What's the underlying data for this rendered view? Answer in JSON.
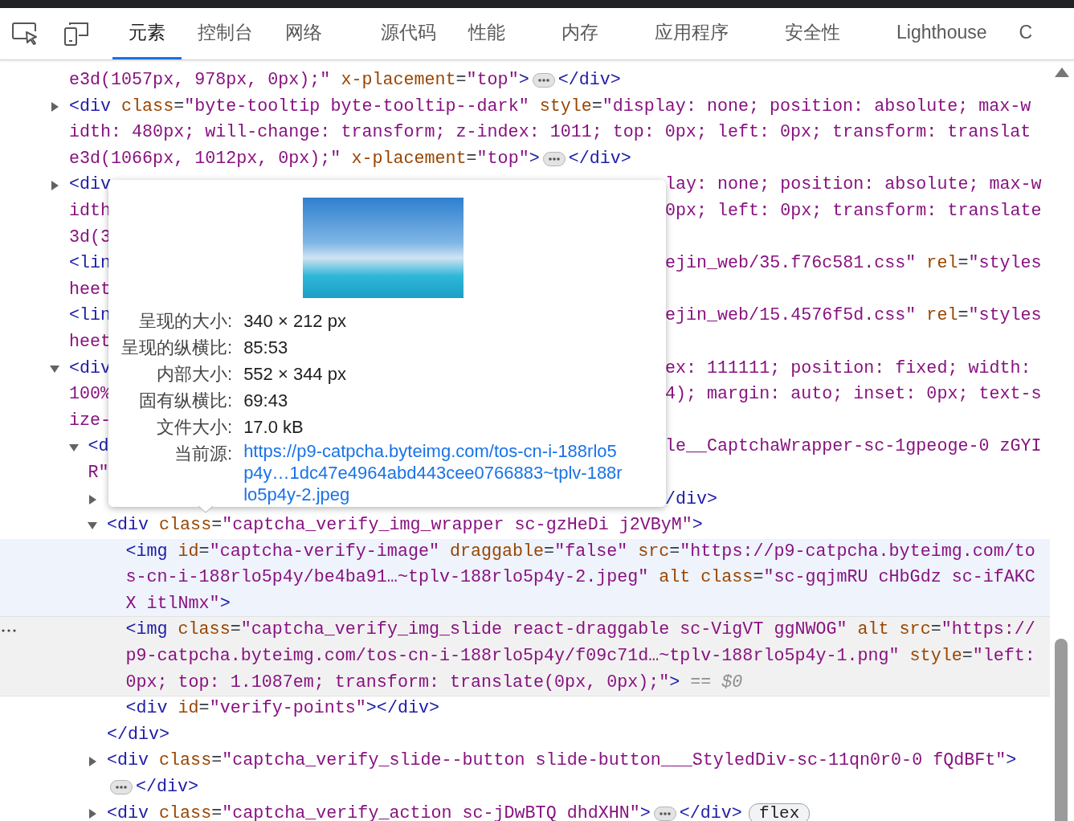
{
  "tabs": [
    {
      "label": "元素",
      "selected": true
    },
    {
      "label": "控制台",
      "selected": false
    },
    {
      "label": "网络",
      "selected": false
    },
    {
      "label": "源代码",
      "selected": false
    },
    {
      "label": "性能",
      "selected": false
    },
    {
      "label": "内存",
      "selected": false
    },
    {
      "label": "应用程序",
      "selected": false
    },
    {
      "label": "安全性",
      "selected": false
    },
    {
      "label": "Lighthouse",
      "selected": false
    },
    {
      "label": "C",
      "selected": false
    }
  ],
  "nodes": [
    {
      "hovered": false,
      "selected": false,
      "lines": [
        [
          {
            "kind": "code",
            "tokens": [
              {
                "kind": "val",
                "text": "e3d(1057px, 978px, 0px);\""
              },
              {
                "kind": "attr",
                "text": " x-placement"
              },
              {
                "kind": "txt",
                "text": "="
              },
              {
                "kind": "val",
                "text": "\"top\""
              },
              {
                "kind": "tag",
                "text": ">"
              }
            ]
          },
          {
            "kind": "ellipsis"
          },
          {
            "kind": "code",
            "tokens": [
              {
                "kind": "tag",
                "text": "</div>"
              }
            ]
          }
        ]
      ]
    },
    {
      "expanded": false,
      "hovered": false,
      "selected": false,
      "lines": [
        [
          {
            "kind": "code",
            "tokens": [
              {
                "kind": "tag",
                "text": "<div"
              },
              {
                "kind": "attr",
                "text": " class"
              },
              {
                "kind": "txt",
                "text": "="
              },
              {
                "kind": "val",
                "text": "\"byte-tooltip byte-tooltip--dark\""
              },
              {
                "kind": "attr",
                "text": " style"
              },
              {
                "kind": "txt",
                "text": "="
              },
              {
                "kind": "val",
                "text": "\"display: none; position: absolute; max-w"
              }
            ]
          }
        ],
        [
          {
            "kind": "code",
            "tokens": [
              {
                "kind": "val",
                "text": "idth: 480px; will-change: transform; z-index: 1011; top: 0px; left: 0px; transform: translat"
              }
            ]
          }
        ],
        [
          {
            "kind": "code",
            "tokens": [
              {
                "kind": "val",
                "text": "e3d(1066px, 1012px, 0px);\""
              },
              {
                "kind": "attr",
                "text": " x-placement"
              },
              {
                "kind": "txt",
                "text": "="
              },
              {
                "kind": "val",
                "text": "\"top\""
              },
              {
                "kind": "tag",
                "text": ">"
              }
            ]
          },
          {
            "kind": "ellipsis"
          },
          {
            "kind": "code",
            "tokens": [
              {
                "kind": "tag",
                "text": "</div>"
              }
            ]
          }
        ]
      ]
    },
    {
      "expanded": false,
      "hovered": false,
      "selected": false,
      "lines": [
        [
          {
            "kind": "code",
            "tokens": [
              {
                "kind": "tag",
                "text": "<div"
              }
            ]
          },
          {
            "kind": "gap"
          },
          {
            "kind": "code",
            "tokens": [
              {
                "kind": "val",
                "text": "lay: none; position: absolute; max-w"
              }
            ]
          }
        ],
        [
          {
            "kind": "code",
            "tokens": [
              {
                "kind": "val",
                "text": "idth"
              }
            ]
          },
          {
            "kind": "gap"
          },
          {
            "kind": "code",
            "tokens": [
              {
                "kind": "val",
                "text": "0px; left: 0px; transform: translate"
              }
            ]
          }
        ],
        [
          {
            "kind": "code",
            "tokens": [
              {
                "kind": "val",
                "text": "3d(3"
              }
            ]
          }
        ]
      ]
    },
    {
      "hovered": false,
      "selected": false,
      "lines": [
        [
          {
            "kind": "code",
            "tokens": [
              {
                "kind": "tag",
                "text": "<lin"
              }
            ]
          },
          {
            "kind": "gap"
          },
          {
            "kind": "code",
            "tokens": [
              {
                "kind": "val",
                "text": "ejin_web/35.f76c581.css\""
              },
              {
                "kind": "attr",
                "text": " rel"
              },
              {
                "kind": "txt",
                "text": "="
              },
              {
                "kind": "val",
                "text": "\"styles"
              }
            ]
          }
        ],
        [
          {
            "kind": "code",
            "tokens": [
              {
                "kind": "val",
                "text": "heet"
              }
            ]
          }
        ]
      ]
    },
    {
      "hovered": false,
      "selected": false,
      "lines": [
        [
          {
            "kind": "code",
            "tokens": [
              {
                "kind": "tag",
                "text": "<lin"
              }
            ]
          },
          {
            "kind": "gap"
          },
          {
            "kind": "code",
            "tokens": [
              {
                "kind": "val",
                "text": "ejin_web/15.4576f5d.css\""
              },
              {
                "kind": "attr",
                "text": " rel"
              },
              {
                "kind": "txt",
                "text": "="
              },
              {
                "kind": "val",
                "text": "\"styles"
              }
            ]
          }
        ],
        [
          {
            "kind": "code",
            "tokens": [
              {
                "kind": "val",
                "text": "heet"
              }
            ]
          }
        ]
      ]
    },
    {
      "expanded": true,
      "hovered": false,
      "selected": false,
      "lines": [
        [
          {
            "kind": "code",
            "tokens": [
              {
                "kind": "tag",
                "text": "<div"
              }
            ]
          },
          {
            "kind": "gap"
          },
          {
            "kind": "code",
            "tokens": [
              {
                "kind": "val",
                "text": "ex: 111111; position: fixed; width:"
              }
            ]
          }
        ],
        [
          {
            "kind": "code",
            "tokens": [
              {
                "kind": "val",
                "text": "100%"
              }
            ]
          },
          {
            "kind": "gap"
          },
          {
            "kind": "code",
            "tokens": [
              {
                "kind": "val",
                "text": "4); margin: auto; inset: 0px; text-s"
              }
            ]
          }
        ],
        [
          {
            "kind": "code",
            "tokens": [
              {
                "kind": "val",
                "text": "ize-"
              }
            ]
          }
        ]
      ],
      "children": [
        {
          "expanded": true,
          "hovered": false,
          "selected": false,
          "lines": [
            [
              {
                "kind": "code",
                "tokens": [
                  {
                    "kind": "tag",
                    "text": "<d"
                  }
                ]
              },
              {
                "kind": "gap"
              },
              {
                "kind": "code",
                "tokens": [
                  {
                    "kind": "val",
                    "text": "le__CaptchaWrapper-sc-1gpeoge-0 zGYI"
                  }
                ]
              }
            ],
            [
              {
                "kind": "code",
                "tokens": [
                  {
                    "kind": "val",
                    "text": "R\""
                  }
                ]
              }
            ]
          ],
          "children": [
            {
              "expanded": false,
              "hovered": false,
              "selected": false,
              "lines": [
                [
                  {
                    "kind": "gap"
                  },
                  {
                    "kind": "code",
                    "tokens": [
                      {
                        "kind": "tag",
                        "text": "/div>"
                      }
                    ]
                  }
                ]
              ]
            },
            {
              "expanded": true,
              "hovered": false,
              "selected": false,
              "lines": [
                [
                  {
                    "kind": "code",
                    "tokens": [
                      {
                        "kind": "tag",
                        "text": "<div"
                      },
                      {
                        "kind": "attr",
                        "text": " class"
                      },
                      {
                        "kind": "txt",
                        "text": "="
                      },
                      {
                        "kind": "val",
                        "text": "\"captcha_verify_img_wrapper sc-gzHeDi j2VByM\""
                      },
                      {
                        "kind": "tag",
                        "text": ">"
                      }
                    ]
                  }
                ]
              ],
              "children": [
                {
                  "hovered": true,
                  "selected": false,
                  "lines": [
                    [
                      {
                        "kind": "code",
                        "tokens": [
                          {
                            "kind": "tag",
                            "text": "<img"
                          },
                          {
                            "kind": "attr",
                            "text": " id"
                          },
                          {
                            "kind": "txt",
                            "text": "="
                          },
                          {
                            "kind": "val",
                            "text": "\"captcha-verify-image\""
                          },
                          {
                            "kind": "attr",
                            "text": " draggable"
                          },
                          {
                            "kind": "txt",
                            "text": "="
                          },
                          {
                            "kind": "val",
                            "text": "\"false\""
                          },
                          {
                            "kind": "attr",
                            "text": " src"
                          },
                          {
                            "kind": "txt",
                            "text": "="
                          },
                          {
                            "kind": "val",
                            "text": "\"https://p9-catpcha.byteimg.com/to"
                          }
                        ]
                      }
                    ],
                    [
                      {
                        "kind": "code",
                        "tokens": [
                          {
                            "kind": "val",
                            "text": "s-cn-i-188rlo5p4y/be4ba91…~tplv-188rlo5p4y-2.jpeg\""
                          },
                          {
                            "kind": "attr",
                            "text": " alt class"
                          },
                          {
                            "kind": "txt",
                            "text": "="
                          },
                          {
                            "kind": "val",
                            "text": "\"sc-gqjmRU cHbGdz sc-ifAKC"
                          }
                        ]
                      }
                    ],
                    [
                      {
                        "kind": "code",
                        "tokens": [
                          {
                            "kind": "val",
                            "text": "X itlNmx\""
                          },
                          {
                            "kind": "tag",
                            "text": ">"
                          }
                        ]
                      }
                    ]
                  ]
                },
                {
                  "hovered": false,
                  "selected": true,
                  "lines": [
                    [
                      {
                        "kind": "code",
                        "tokens": [
                          {
                            "kind": "tag",
                            "text": "<img"
                          },
                          {
                            "kind": "attr",
                            "text": " class"
                          },
                          {
                            "kind": "txt",
                            "text": "="
                          },
                          {
                            "kind": "val",
                            "text": "\"captcha_verify_img_slide react-draggable sc-VigVT ggNWOG\""
                          },
                          {
                            "kind": "attr",
                            "text": " alt src"
                          },
                          {
                            "kind": "txt",
                            "text": "="
                          },
                          {
                            "kind": "val",
                            "text": "\"https://"
                          }
                        ]
                      }
                    ],
                    [
                      {
                        "kind": "code",
                        "tokens": [
                          {
                            "kind": "val",
                            "text": "p9-catpcha.byteimg.com/tos-cn-i-188rlo5p4y/f09c71d…~tplv-188rlo5p4y-1.png\""
                          },
                          {
                            "kind": "attr",
                            "text": " style"
                          },
                          {
                            "kind": "txt",
                            "text": "="
                          },
                          {
                            "kind": "val",
                            "text": "\"left:"
                          }
                        ]
                      }
                    ],
                    [
                      {
                        "kind": "code",
                        "tokens": [
                          {
                            "kind": "val",
                            "text": "0px; top: 1.1087em; transform: translate(0px, 0px);\""
                          },
                          {
                            "kind": "tag",
                            "text": ">"
                          },
                          {
                            "kind": "dim",
                            "text": " == $0"
                          }
                        ]
                      }
                    ]
                  ]
                },
                {
                  "hovered": false,
                  "selected": false,
                  "lines": [
                    [
                      {
                        "kind": "code",
                        "tokens": [
                          {
                            "kind": "tag",
                            "text": "<div"
                          },
                          {
                            "kind": "attr",
                            "text": " id"
                          },
                          {
                            "kind": "txt",
                            "text": "="
                          },
                          {
                            "kind": "val",
                            "text": "\"verify-points\""
                          },
                          {
                            "kind": "tag",
                            "text": "></div>"
                          }
                        ]
                      }
                    ]
                  ]
                }
              ],
              "closing": [
                {
                  "kind": "code",
                  "tokens": [
                    {
                      "kind": "tag",
                      "text": "</div>"
                    }
                  ]
                }
              ]
            },
            {
              "expanded": false,
              "hovered": false,
              "selected": false,
              "lines": [
                [
                  {
                    "kind": "code",
                    "tokens": [
                      {
                        "kind": "tag",
                        "text": "<div"
                      },
                      {
                        "kind": "attr",
                        "text": " class"
                      },
                      {
                        "kind": "txt",
                        "text": "="
                      },
                      {
                        "kind": "val",
                        "text": "\"captcha_verify_slide--button slide-button___StyledDiv-sc-11qn0r0-0 fQdBFt\""
                      },
                      {
                        "kind": "tag",
                        "text": ">"
                      }
                    ]
                  }
                ],
                [
                  {
                    "kind": "ellipsis"
                  },
                  {
                    "kind": "code",
                    "tokens": [
                      {
                        "kind": "tag",
                        "text": "</div>"
                      }
                    ]
                  }
                ]
              ]
            },
            {
              "expanded": false,
              "hovered": false,
              "selected": false,
              "lines": [
                [
                  {
                    "kind": "code",
                    "tokens": [
                      {
                        "kind": "tag",
                        "text": "<div"
                      },
                      {
                        "kind": "attr",
                        "text": " class"
                      },
                      {
                        "kind": "txt",
                        "text": "="
                      },
                      {
                        "kind": "val",
                        "text": "\"captcha_verify_action sc-jDwBTQ dhdXHN\""
                      },
                      {
                        "kind": "tag",
                        "text": ">"
                      }
                    ]
                  },
                  {
                    "kind": "ellipsis"
                  },
                  {
                    "kind": "code",
                    "tokens": [
                      {
                        "kind": "tag",
                        "text": "</div>"
                      }
                    ]
                  },
                  {
                    "kind": "badge",
                    "text": "flex"
                  }
                ]
              ]
            }
          ]
        }
      ]
    }
  ],
  "tooltip": {
    "rows": [
      {
        "kind": "text",
        "label": "呈现的大小:",
        "value": "340 × 212 px"
      },
      {
        "kind": "text",
        "label": "呈现的纵横比:",
        "value": "85:53"
      },
      {
        "kind": "text",
        "label": "内部大小:",
        "value": "552 × 344 px"
      },
      {
        "kind": "text",
        "label": "固有纵横比:",
        "value": "69:43"
      },
      {
        "kind": "text",
        "label": "文件大小:",
        "value": "17.0 kB"
      },
      {
        "kind": "link",
        "label": "当前源:",
        "value": "https://p9-catpcha.byteimg.com/tos-cn-i-188rlo5p4y…1dc47e4964abd443cee0766883~tplv-188rlo5p4y-2.jpeg"
      }
    ]
  }
}
